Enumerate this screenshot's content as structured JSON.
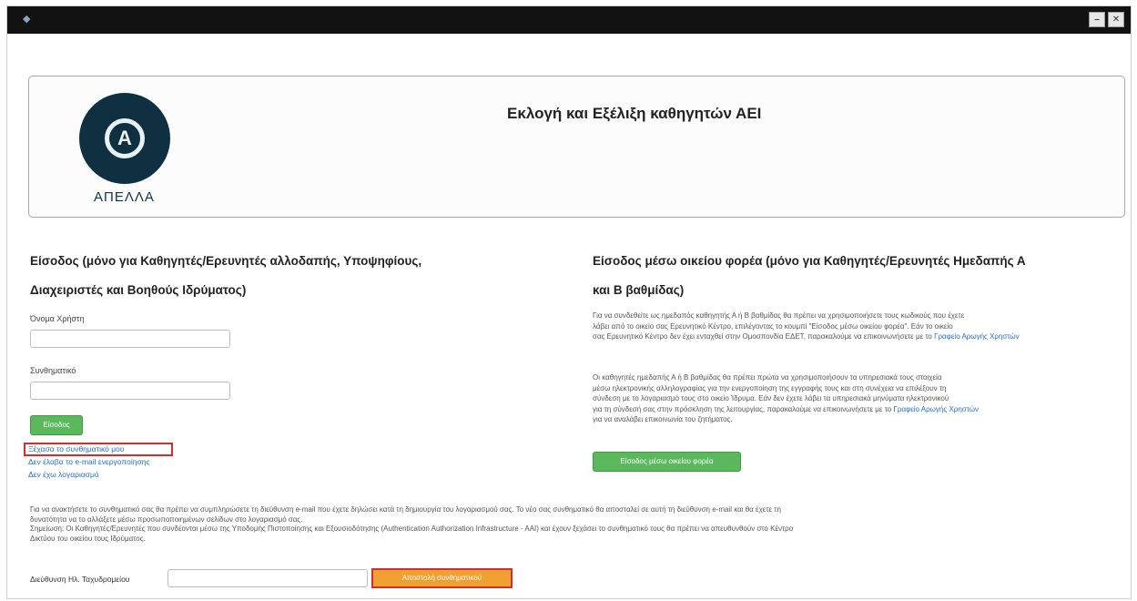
{
  "window": {
    "title": "",
    "minimize_label": "⎯",
    "close_label": "✕"
  },
  "header": {
    "logo_text": "ΑΠΕΛΛΑ",
    "title": "Εκλογή και Εξέλιξη καθηγητών ΑΕΙ"
  },
  "left": {
    "title_line1": "Είσοδος (μόνο για Καθηγητές/Ερευνητές αλλοδαπής, Υποψηφίους,",
    "title_line2": "Διαχειριστές και Βοηθούς Ιδρύματος)",
    "username_label": "Όνομα Χρήστη",
    "password_label": "Συνθηματικό",
    "login_button": "Είσοδος",
    "forgot_password": "Ξέχασα το συνθηματικό μου",
    "no_email_link": "Δεν έλαβα το e-mail ενεργοποίησης",
    "no_account_link": "Δεν έχω λογαριασμό"
  },
  "right": {
    "title_line1": "Είσοδος μέσω οικείου φορέα (μόνο για Καθηγητές/Ερευνητές Ημεδαπής Α",
    "title_line2": "και Β βαθμίδας)",
    "para1_lines": [
      "Για να συνδεθείτε ως ημεδαπός καθηγητής Α ή Β βαθμίδας θα πρέπει να χρησιμοποιήσετε τους κωδικούς που έχετε",
      "λάβει από το οικείο σας Ερευνητικό Κέντρο, επιλέγοντας το κουμπί \"Είσοδος μέσω οικείου φορέα\". Εάν το οικείο",
      "σας Ερευνητικό Κέντρο δεν έχει ενταχθεί στην Ομοσπονδία ΕΔΕΤ, παρακαλούμε να επικοινωνήσετε με το"
    ],
    "para1_link": "Γραφείο Αρωγής Χρηστών",
    "para2_lines": [
      "Οι καθηγητές ημεδαπής Α ή Β βαθμίδας θα πρέπει πρώτα να χρησιμοποιήσουν τα υπηρεσιακά τους στοιχεία",
      "μέσω ηλεκτρονικής αλληλογραφίας για την ενεργοποίηση της εγγραφής τους και στη συνέχεια να επιλέξουν τη",
      "σύνδεση με το λογαριασμό τους στο οικείο Ίδρυμα. Εάν δεν έχετε λάβει τα υπηρεσιακά μηνύματα ηλεκτρονικού",
      "για τη σύνδεσή σας στην πρόσκληση της λειτουργίας, παρακαλούμε να επικοινωνήσετε με το"
    ],
    "para2_link": "Γραφείο Αρωγής Χρηστών",
    "para2_tail": "για να αναλάβει επικοινωνία του ζητήματος.",
    "fed_button": "Είσοδος μέσω οικείου φορέα"
  },
  "bottom": {
    "note_lines": [
      "Για να ανακτήσετε το συνθηματικό σας θα πρέπει να συμπληρώσετε τη διεύθυνση e-mail που έχετε δηλώσει κατά τη δημιουργία του λογαριασμού σας. Το νέο σας συνθηματικό θα αποσταλεί σε αυτή τη διεύθυνση e-mail και θα έχετε τη",
      "δυνατότητα να το αλλάξετε μέσω προσωποποιημένων σελίδων στο λογαριασμό σας.",
      "Σημείωση: Οι Καθηγητές/Ερευνητές που συνδέονται μέσω της Υποδομής Πιστοποίησης και Εξουσιοδότησης (Authentication Authorization Infrastructure - AAI) και έχουν ξεχάσει το συνθηματικό τους θα πρέπει να απευθυνθούν στο Κέντρο",
      "Δικτύου του οικείου τους Ιδρύματος."
    ],
    "email_label": "Διεύθυνση Ηλ. Ταχυδρομείου",
    "send_button": "Αποστολή συνθηματικού"
  }
}
